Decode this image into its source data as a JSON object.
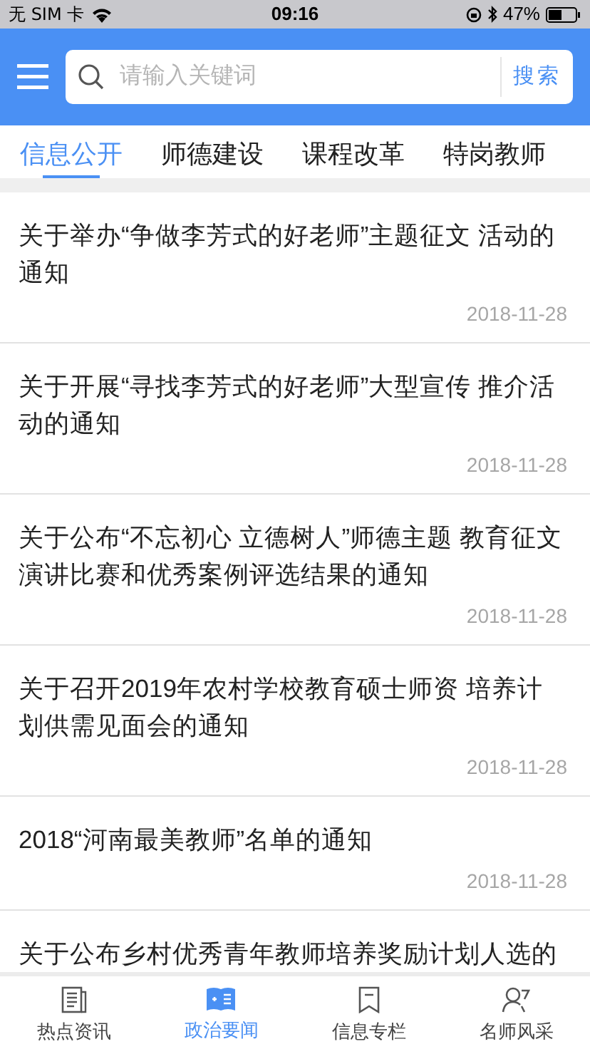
{
  "status_bar": {
    "carrier": "无 SIM 卡",
    "time": "09:16",
    "battery": "47%"
  },
  "search": {
    "placeholder": "请输入关键词",
    "button": "搜索"
  },
  "tabs": [
    {
      "label": "信息公开",
      "selected": true
    },
    {
      "label": "师德建设",
      "selected": false
    },
    {
      "label": "课程改革",
      "selected": false
    },
    {
      "label": "特岗教师",
      "selected": false
    }
  ],
  "articles": [
    {
      "title": "关于举办“争做李芳式的好老师”主题征文 活动的通知",
      "date": "2018-11-28"
    },
    {
      "title": "关于开展“寻找李芳式的好老师”大型宣传 推介活动的通知",
      "date": "2018-11-28"
    },
    {
      "title": "关于公布“不忘初心 立德树人”师德主题 教育征文演讲比赛和优秀案例评选结果的通知",
      "date": "2018-11-28"
    },
    {
      "title": "关于召开2019年农村学校教育硕士师资 培养计划供需见面会的通知",
      "date": "2018-11-28"
    },
    {
      "title": "2018“河南最美教师”名单的通知",
      "date": "2018-11-28"
    },
    {
      "title": "关于公布乡村优秀青年教师培养奖励计划人选的"
    }
  ],
  "bottom_nav": [
    {
      "label": "热点资讯",
      "selected": false
    },
    {
      "label": "政治要闻",
      "selected": true
    },
    {
      "label": "信息专栏",
      "selected": false
    },
    {
      "label": "名师风采",
      "selected": false
    }
  ]
}
